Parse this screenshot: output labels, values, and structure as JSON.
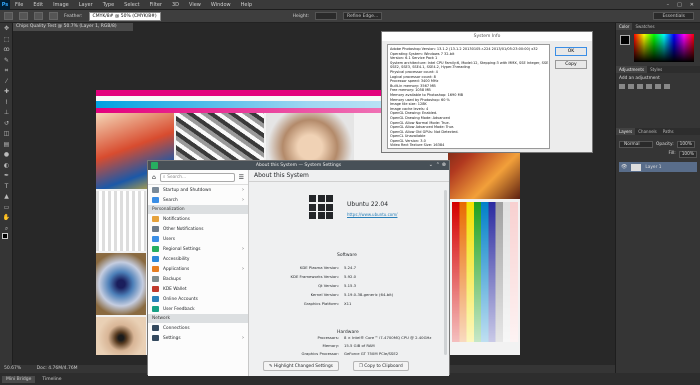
{
  "menubar": {
    "logo": "Ps",
    "items": [
      "File",
      "Edit",
      "Image",
      "Layer",
      "Type",
      "Select",
      "Filter",
      "3D",
      "View",
      "Window",
      "Help"
    ],
    "window_controls": [
      "–",
      "□",
      "✕"
    ]
  },
  "options": {
    "tooltip": "CMYK/8# @ 50% (CMYK/8#)",
    "feather_label": "Feather:",
    "height_label": "Height:",
    "refine_label": "Refine Edge...",
    "workspace": "Essentials"
  },
  "document": {
    "tab": "Chips Quality Test @ 50.7% (Layer 1, RGB/8)",
    "zoom": "50.67%",
    "doc_size": "Doc: 4.76M/4.76M"
  },
  "bottom_tabs": [
    "Mini Bridge",
    "Timeline"
  ],
  "right_panel": {
    "color_tabs": [
      "Color",
      "Swatches"
    ],
    "adjust_tabs": [
      "Adjustments",
      "Styles"
    ],
    "adjust_title": "Add an adjustment",
    "layers_tabs": [
      "Layers",
      "Channels",
      "Paths"
    ],
    "blend_mode": "Normal",
    "opacity_label": "Opacity:",
    "opacity_value": "100%",
    "fill_label": "Fill:",
    "fill_value": "100%",
    "layer_name": "Layer 1"
  },
  "sysinfo": {
    "title": "System Info",
    "ok": "OK",
    "copy": "Copy",
    "lines": [
      "Adobe Photoshop Version: 13.1.2 (13.1.2 20130105.r.224 2013/01/05:23:00:00) x32",
      "Operating System: Windows 7 32-bit",
      "Version: 6.1 Service Pack 1",
      "System architecture: Intel CPU Family:6, Model:12, Stepping:3 with MMX, SSE Integer, SSE FP,",
      "SSE2, SSE3, SSE4.1, SSE4.2, Hyper-Threading",
      "Physical processor count: 4",
      "Logical processor count: 8",
      "Processor speed: 3400 MHz",
      "Built-in memory: 3567 MB",
      "Free memory: 1058 MB",
      "Memory available to Photoshop: 1690 MB",
      "Memory used by Photoshop: 60 %",
      "Image tile size: 128K",
      "Image cache levels: 4",
      "OpenGL Drawing: Enabled.",
      "OpenGL Drawing Mode: Advanced",
      "OpenGL Allow Normal Mode: True.",
      "OpenGL Allow Advanced Mode: True.",
      "OpenGL Allow Old GPUs: Not Detected.",
      "OpenCL Unavailable",
      "OpenGL Version: 3.0",
      "Video Rect Texture Size: 16384"
    ]
  },
  "kde": {
    "title": "About this System — System Settings",
    "search_placeholder": "Search...",
    "page_title": "About this System",
    "sidebar": [
      {
        "kind": "item",
        "label": "Startup and Shutdown",
        "color": "#7a8a99",
        "chev": true
      },
      {
        "kind": "item",
        "label": "Search",
        "color": "#3a8ee6",
        "chev": true
      },
      {
        "kind": "section",
        "label": "Personalization"
      },
      {
        "kind": "item",
        "label": "Notifications",
        "color": "#e6a23c",
        "chev": false
      },
      {
        "kind": "item",
        "label": "Other Notifications",
        "color": "#6c7a89",
        "chev": false
      },
      {
        "kind": "item",
        "label": "Users",
        "color": "#3a8ee6",
        "chev": false
      },
      {
        "kind": "item",
        "label": "Regional Settings",
        "color": "#27ae60",
        "chev": true
      },
      {
        "kind": "item",
        "label": "Accessibility",
        "color": "#2c88d9",
        "chev": false
      },
      {
        "kind": "item",
        "label": "Applications",
        "color": "#e67e22",
        "chev": true
      },
      {
        "kind": "item",
        "label": "Backups",
        "color": "#7f8c8d",
        "chev": false
      },
      {
        "kind": "item",
        "label": "KDE Wallet",
        "color": "#c0392b",
        "chev": false
      },
      {
        "kind": "item",
        "label": "Online Accounts",
        "color": "#2980b9",
        "chev": false
      },
      {
        "kind": "item",
        "label": "User Feedback",
        "color": "#16a085",
        "chev": false
      },
      {
        "kind": "section",
        "label": "Network"
      },
      {
        "kind": "item",
        "label": "Connections",
        "color": "#34495e",
        "chev": false
      },
      {
        "kind": "item",
        "label": "Settings",
        "color": "#34495e",
        "chev": true
      }
    ],
    "distro": "Ubuntu 22.04",
    "url": "https://www.ubuntu.com/",
    "software_title": "Software",
    "software": [
      {
        "k": "KDE Plasma Version:",
        "v": "5.24.7"
      },
      {
        "k": "KDE Frameworks Version:",
        "v": "5.92.0"
      },
      {
        "k": "Qt Version:",
        "v": "5.15.3"
      },
      {
        "k": "Kernel Version:",
        "v": "5.19.0-38-generic (64-bit)"
      },
      {
        "k": "Graphics Platform:",
        "v": "X11"
      }
    ],
    "hardware_title": "Hardware",
    "hardware": [
      {
        "k": "Processors:",
        "v": "8 × Intel® Core™ i7-4700MQ CPU @ 2.40GHz"
      },
      {
        "k": "Memory:",
        "v": "15.5 GiB of RAM"
      },
      {
        "k": "Graphics Processor:",
        "v": "GeForce GT 750M PCIe/SSE2"
      }
    ],
    "highlight_btn": "Highlight Changed Settings",
    "copy_btn": "Copy to Clipboard"
  }
}
